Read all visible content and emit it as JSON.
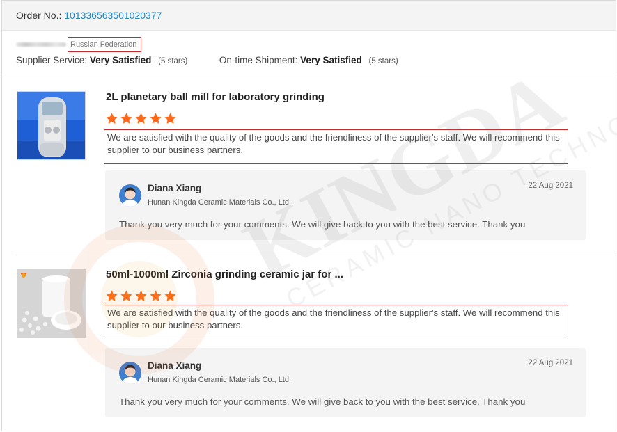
{
  "order": {
    "label": "Order No.:",
    "number": "101336563501020377"
  },
  "buyer": {
    "country": "Russian Federation"
  },
  "ratings": {
    "supplier_label": "Supplier Service:",
    "supplier_value": "Very Satisfied",
    "supplier_stars": "(5 stars)",
    "shipment_label": "On-time Shipment:",
    "shipment_value": "Very Satisfied",
    "shipment_stars": "(5 stars)"
  },
  "reviews": [
    {
      "product_title": "2L planetary ball mill for laboratory grinding",
      "rating": 5,
      "comment": "We are satisfied with the quality of the goods and the friendliness of the supplier's staff. We will recommend this supplier to our business partners.",
      "reply": {
        "name": "Diana Xiang",
        "company": "Hunan Kingda Ceramic Materials Co., Ltd.",
        "date": "22 Aug 2021",
        "text": "Thank you very much for your comments. We will give back to you with the best service. Thank you"
      }
    },
    {
      "product_title": "50ml-1000ml Zirconia grinding ceramic jar for ...",
      "rating": 5,
      "comment": "We are satisfied with the quality of the goods and the friendliness of the supplier's staff. We will recommend this supplier to our business partners.",
      "reply": {
        "name": "Diana Xiang",
        "company": "Hunan Kingda Ceramic Materials Co., Ltd.",
        "date": "22 Aug 2021",
        "text": "Thank you very much for your comments. We will give back to you with the best service. Thank you"
      }
    }
  ],
  "watermark": {
    "brand": "KINGDA",
    "tagline": "CERAMIC NANO TECHNOLOGY"
  },
  "colors": {
    "star": "#ff6a1a",
    "link": "#1e88c8",
    "highlight_box": "#c72a2a"
  }
}
